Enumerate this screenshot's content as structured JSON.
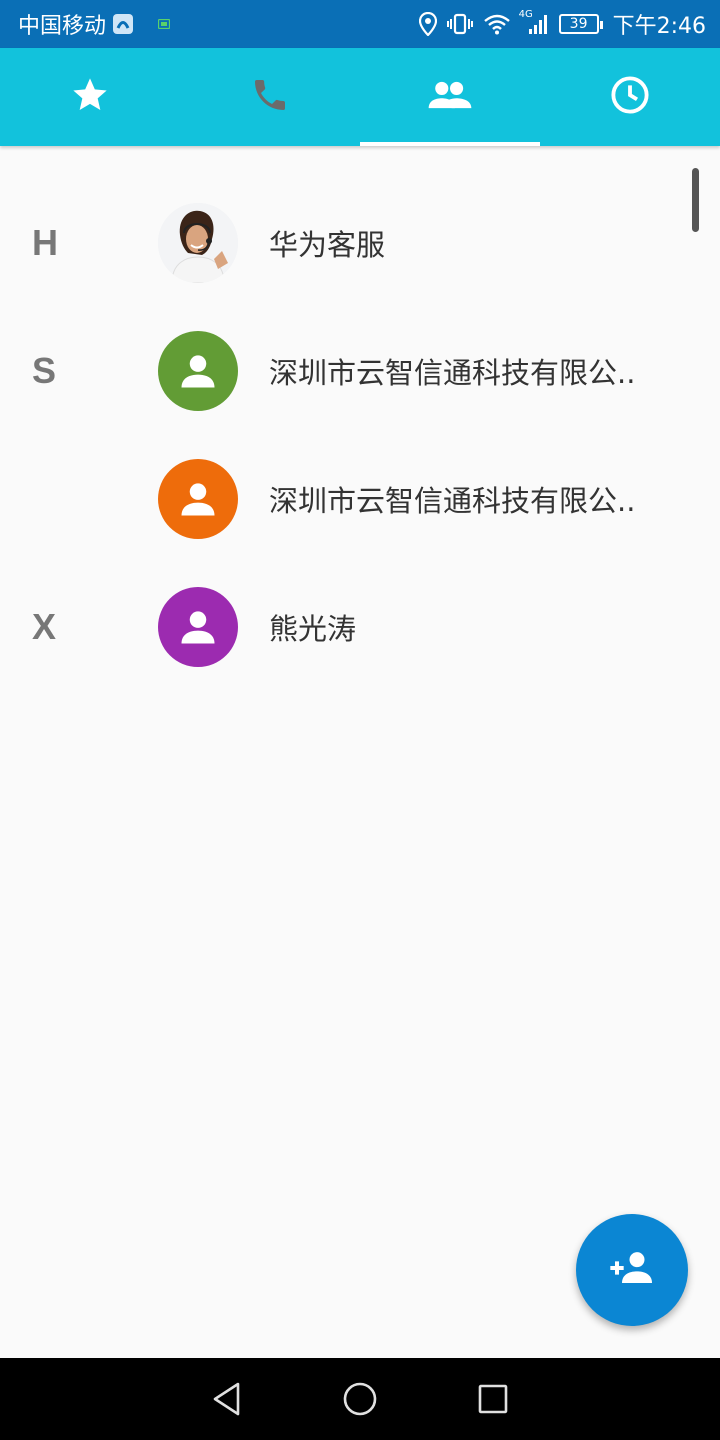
{
  "status_bar": {
    "carrier": "中国移动",
    "network": "4G",
    "battery": "39",
    "time": "下午2:46"
  },
  "tabs": [
    {
      "icon": "star-icon",
      "active": false
    },
    {
      "icon": "phone-icon",
      "active": false
    },
    {
      "icon": "contacts-icon",
      "active": true
    },
    {
      "icon": "clock-icon",
      "active": false
    }
  ],
  "contacts": [
    {
      "letter": "H",
      "name": "华为客服",
      "avatar": "photo",
      "color": "#e8e0d8"
    },
    {
      "letter": "S",
      "name": "深圳市云智信通科技有限公..",
      "avatar": "person",
      "color": "#629c35"
    },
    {
      "letter": "",
      "name": "深圳市云智信通科技有限公..",
      "avatar": "person",
      "color": "#ee6c0b"
    },
    {
      "letter": "X",
      "name": "熊光涛",
      "avatar": "person",
      "color": "#9c2bb0"
    }
  ],
  "colors": {
    "status_bar": "#0a6fb6",
    "tab_bar": "#12c2dc",
    "fab": "#0b86d3"
  }
}
